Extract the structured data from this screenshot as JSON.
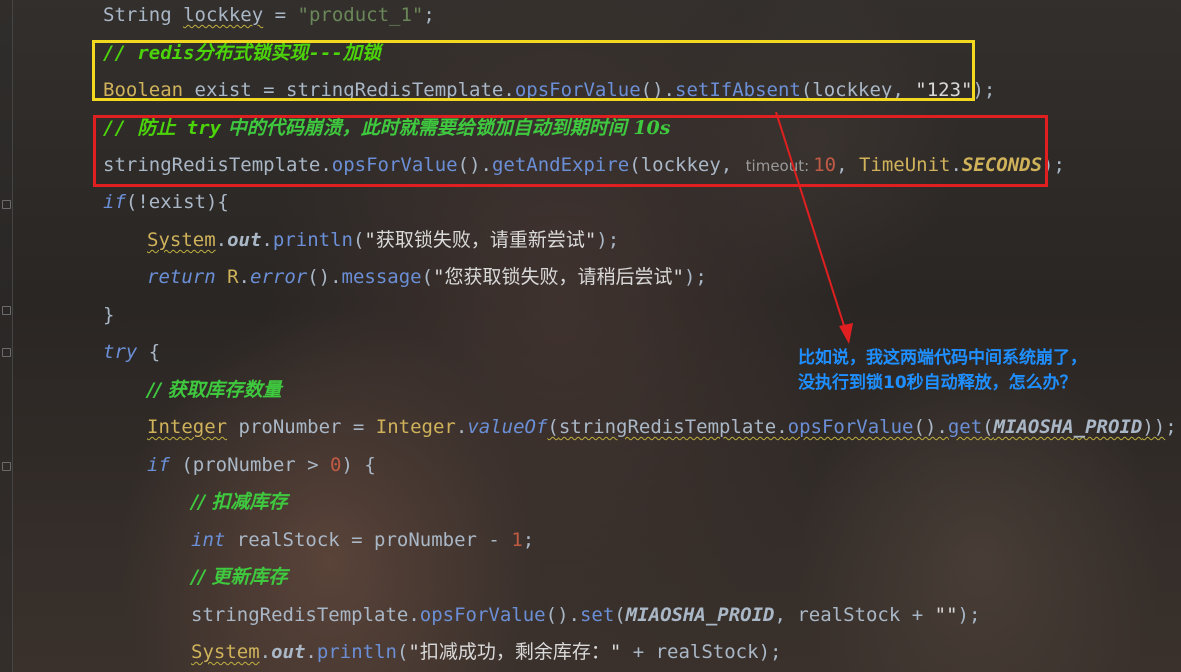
{
  "code": {
    "l1": {
      "type": "String",
      "var": "lockkey",
      "eq": " = ",
      "val": "\"product_1\"",
      "end": ";"
    },
    "l2": {
      "comment": "// redis分布式锁实现---加锁"
    },
    "l3": {
      "type": "Boolean",
      "var": " exist = ",
      "obj": "stringRedisTemplate",
      "m1": "opsForValue",
      "m2": "setIfAbsent",
      "arg1": "lockkey",
      "arg2": "\"123\""
    },
    "l4": {
      "comment_a": "// 防止 ",
      "comment_b": "try",
      "comment_c": " 中的代码崩溃，此时就需要给锁加自动到期时间 10s"
    },
    "l5": {
      "obj": "stringRedisTemplate",
      "m1": "opsForValue",
      "m2": "getAndExpire",
      "arg1": "lockkey",
      "hint": "timeout:",
      "num": "10",
      "cls": "TimeUnit",
      "const": "SECONDS"
    },
    "l6": {
      "kw": "if",
      "cond": "(!exist){"
    },
    "l7": {
      "cls": "System",
      "fld": "out",
      "m": "println",
      "str": "\"获取锁失败，请重新尝试\""
    },
    "l8": {
      "kw": "return",
      "cls": "R",
      "m1": "error",
      "m2": "message",
      "str": "\"您获取锁失败，请稍后尝试\""
    },
    "l9": {
      "text": "}"
    },
    "l10": {
      "kw": "try",
      "text": " {"
    },
    "l11": {
      "comment": "// 获取库存数量"
    },
    "l12": {
      "type": "Integer",
      "var": " proNumber = ",
      "cls": "Integer",
      "m1": "valueOf",
      "obj": "stringRedisTemplate",
      "m2": "opsForValue",
      "m3": "get",
      "const": "MIAOSHA_PROID"
    },
    "l13": {
      "kw": "if",
      "var": " (proNumber > ",
      "num": "0",
      "end": ") {"
    },
    "l14": {
      "comment": "// 扣减库存"
    },
    "l15": {
      "kw": "int",
      "var": " realStock = proNumber - ",
      "num": "1",
      "end": ";"
    },
    "l16": {
      "comment": "// 更新库存"
    },
    "l17": {
      "obj": "stringRedisTemplate",
      "m1": "opsForValue",
      "m2": "set",
      "const": "MIAOSHA_PROID",
      "tail": ", realStock + ",
      "str": "\"\"",
      "end": ");"
    },
    "l18": {
      "cls": "System",
      "fld": "out",
      "m": "println",
      "str": "\"扣减成功，剩余库存：\"",
      "tail": " + realStock);"
    }
  },
  "annotation": {
    "line1": "比如说，我这两端代码中间系统崩了，",
    "line2": "没执行到锁10秒自动释放，怎么办？"
  },
  "colors": {
    "yellow_box": "#f2d81e",
    "red_box": "#e02020",
    "annotation_text": "#1f8fff",
    "arrow": "#e02020"
  }
}
